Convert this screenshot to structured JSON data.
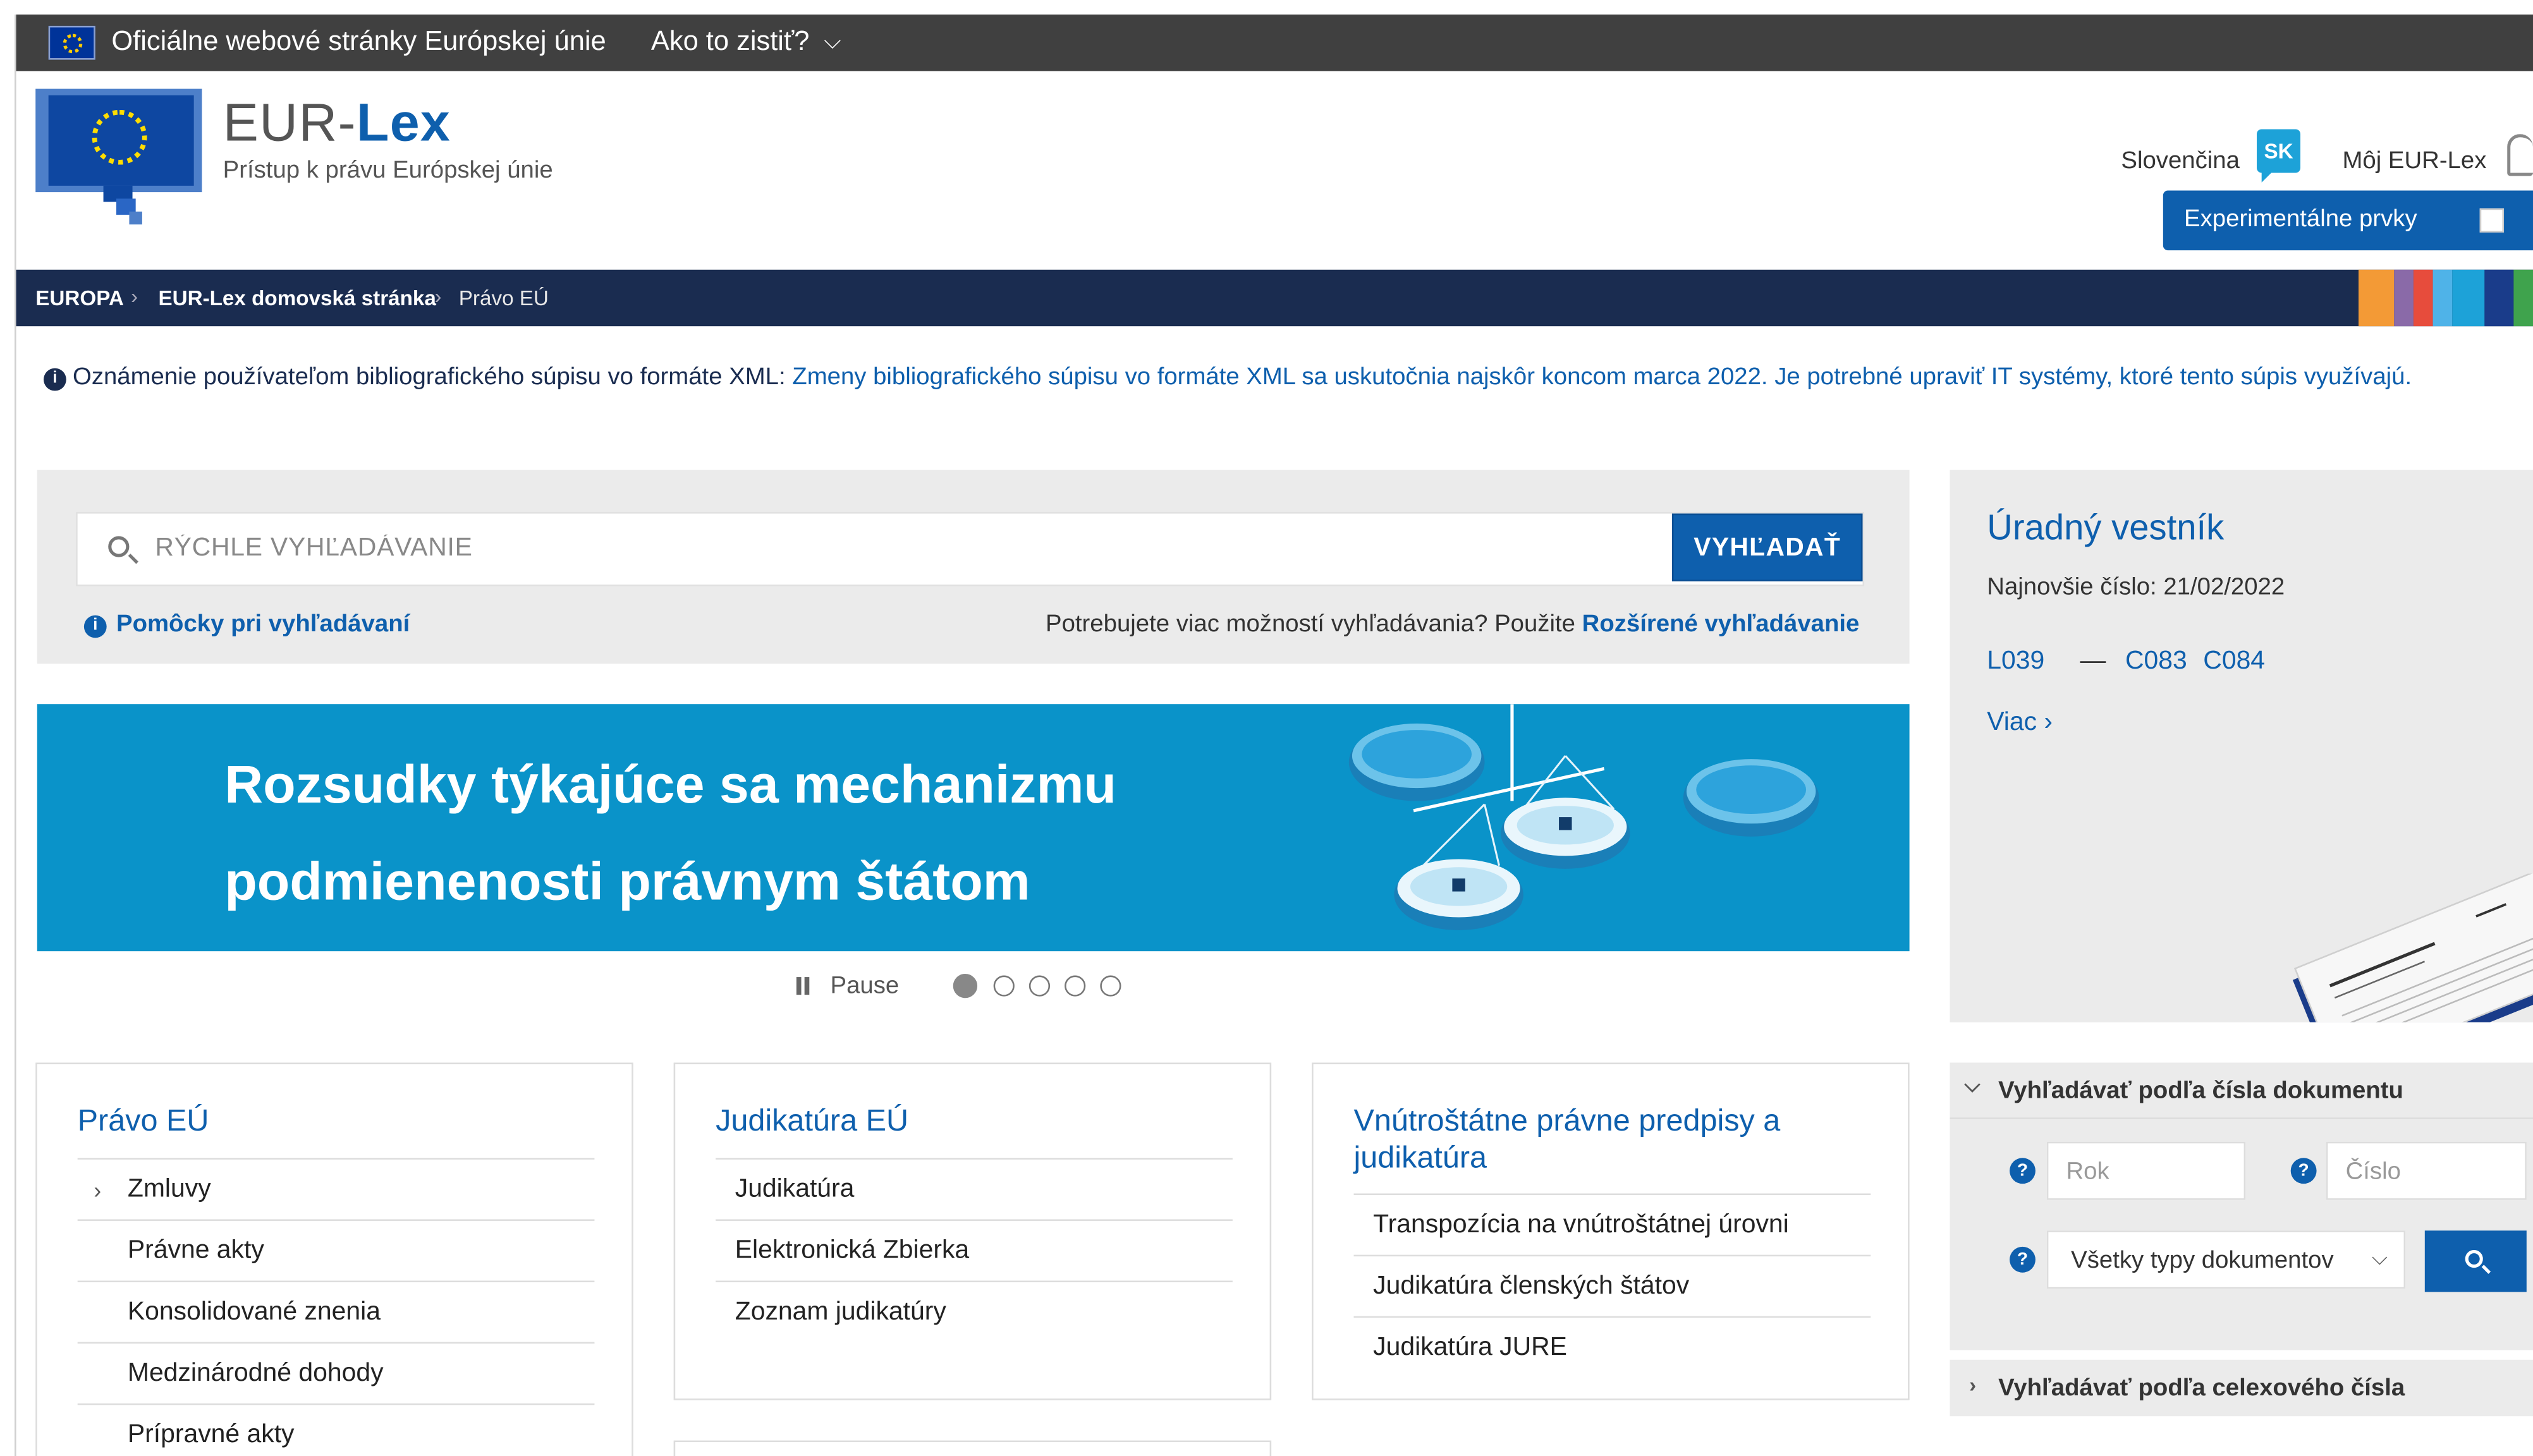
{
  "eu_bar": {
    "official_text": "Oficiálne webové stránky Európskej únie",
    "how_to_know": "Ako to zistiť?"
  },
  "header": {
    "brand_prefix": "EUR-",
    "brand_suffix": "Lex",
    "subtitle": "Prístup k právu Európskej únie",
    "language_label": "Slovenčina",
    "language_code": "SK",
    "my_eurlex": "Môj EUR-Lex",
    "experimental_label": "Experimentálne prvky"
  },
  "breadcrumb": {
    "items": [
      "EUROPA",
      "EUR-Lex domovská stránka",
      "Právo EÚ"
    ]
  },
  "notice": {
    "lead": "Oznámenie používateľom bibliografického súpisu vo formáte XML:",
    "body": " Zmeny bibliografického súpisu vo formáte XML sa uskutočnia najskôr koncom marca 2022. Je potrebné upraviť IT systémy, ktoré tento súpis využívajú."
  },
  "search": {
    "placeholder": "RÝCHLE VYHĽADÁVANIE",
    "button_label": "VYHĽADAŤ",
    "help_link": "Pomôcky pri vyhľadávaní",
    "advanced_prompt": "Potrebujete viac možností vyhľadávania? Použite ",
    "advanced_link": "Rozšírené vyhľadávanie"
  },
  "banner": {
    "line1": "Rozsudky týkajúce sa mechanizmu",
    "line2": "podmienenosti právnym štátom"
  },
  "carousel": {
    "pause_label": "Pause",
    "slide_count": 5,
    "active_slide": 1
  },
  "cards": [
    {
      "title": "Právo EÚ",
      "items": [
        "Zmluvy",
        "Právne akty",
        "Konsolidované znenia",
        "Medzinárodné dohody",
        "Prípravné akty"
      ]
    },
    {
      "title": "Judikatúra EÚ",
      "items": [
        "Judikatúra",
        "Elektronická Zbierka",
        "Zoznam judikatúry"
      ]
    },
    {
      "title": "Vnútroštátne právne predpisy a judikatúra",
      "items": [
        "Transpozícia na vnútroštátnej úrovni",
        "Judikatúra členských štátov",
        "Judikatúra JURE"
      ]
    }
  ],
  "official_journal": {
    "title": "Úradný vestník",
    "latest": "Najnovšie číslo: 21/02/2022",
    "links": [
      "L039",
      "C083",
      "C084"
    ],
    "dash": "—",
    "more": "Viac ›"
  },
  "doc_search": {
    "header": "Vyhľadávať podľa čísla dokumentu",
    "year_placeholder": "Rok",
    "number_placeholder": "Číslo",
    "doc_type": "Všetky typy dokumentov",
    "help_mark": "?"
  },
  "celex_search": {
    "header": "Vyhľadávať podľa celexového čísla"
  },
  "colors": {
    "eu_bar": "#404040",
    "primary_blue": "#0e5fad",
    "breadcrumb_bg": "#1a2c50",
    "banner_bg": "#0a93c9",
    "panel_grey": "#ebebeb",
    "lang_badge": "#1da2d8"
  },
  "icons": [
    "eu-flag-icon",
    "chevron-down-icon",
    "user-icon",
    "info-icon",
    "search-icon",
    "pause-icon",
    "question-icon",
    "chevron-right-icon"
  ]
}
